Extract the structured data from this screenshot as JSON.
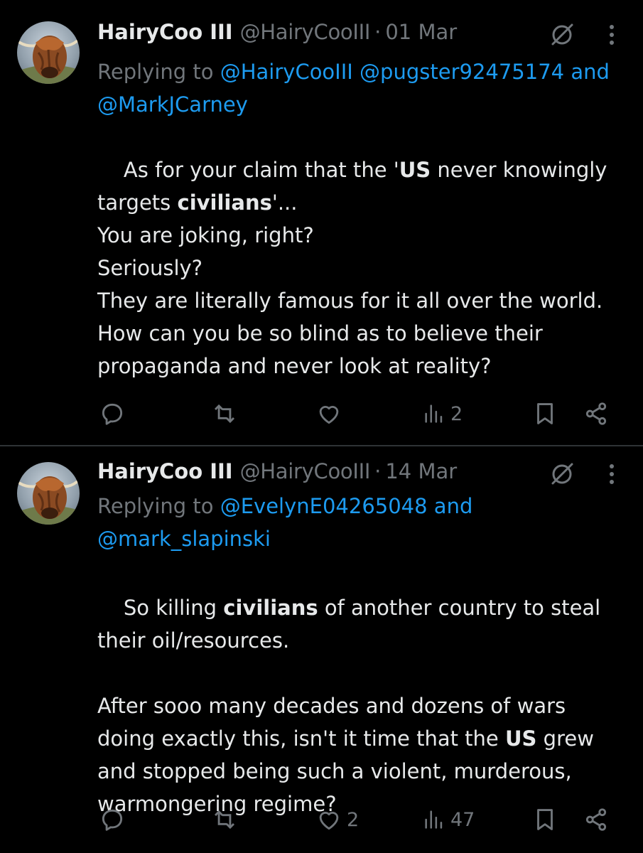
{
  "tweets": [
    {
      "display_name": "HairyCoo III",
      "handle": "@HairyCooIII",
      "separator": "·",
      "date": "01 Mar",
      "replying_prefix": "Replying to",
      "mentions_line1": "@HairyCooIII @pugster92475174",
      "reply_and": "and",
      "mention_line2": "@MarkJCarney",
      "body": [
        {
          "t": "As for your claim that the '"
        },
        {
          "t": "US",
          "b": true
        },
        {
          "t": " never knowingly targets "
        },
        {
          "t": "civilians",
          "b": true
        },
        {
          "t": "'...\nYou are joking, right?\nSeriously?\nThey are literally famous for it all over the world.\nHow can you be so blind as to believe their propaganda and never look at reality?"
        }
      ],
      "stats": {
        "replies": "",
        "reposts": "",
        "likes": "",
        "views": "2"
      }
    },
    {
      "display_name": "HairyCoo III",
      "handle": "@HairyCooIII",
      "separator": "·",
      "date": "14 Mar",
      "replying_prefix": "Replying to",
      "mentions_line1": "@EvelynE04265048",
      "reply_and": "and",
      "mention_line2": "@mark_slapinski",
      "body": [
        {
          "t": "So killing "
        },
        {
          "t": "civilians",
          "b": true
        },
        {
          "t": " of another country to steal their oil/resources.\n\nAfter sooo many decades and dozens of wars doing exactly this, isn't it time that the "
        },
        {
          "t": "US",
          "b": true
        },
        {
          "t": " grew and stopped being such a violent, murderous, warmongering regime?"
        }
      ],
      "stats": {
        "replies": "",
        "reposts": "",
        "likes": "2",
        "views": "47"
      }
    }
  ],
  "icons": {
    "reply": "reply-icon",
    "repost": "repost-icon",
    "like": "like-icon",
    "views": "views-icon",
    "bookmark": "bookmark-icon",
    "share": "share-icon",
    "grok": "grok-icon",
    "more": "more-icon"
  },
  "colors": {
    "background": "#000000",
    "text": "#e7e9ea",
    "muted": "#71767b",
    "link": "#1d9bf0",
    "divider": "#2f3336"
  }
}
